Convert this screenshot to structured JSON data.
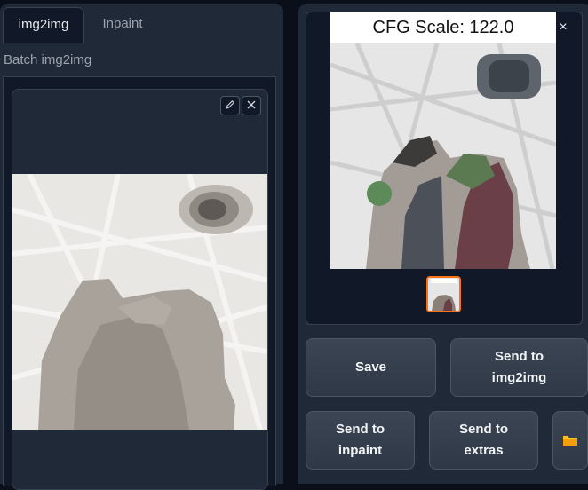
{
  "left_tabs": {
    "items": [
      {
        "label": "img2img",
        "active": true
      },
      {
        "label": "Inpaint",
        "active": false
      }
    ],
    "batch_label": "Batch img2img"
  },
  "image_editor": {
    "edit_icon": "pencil-icon",
    "close_icon": "close-icon"
  },
  "gallery": {
    "caption": "CFG Scale: 122.0",
    "close_label": "×",
    "selected_thumbnail": 1
  },
  "actions": {
    "save": "Save",
    "send_img2img": "Send to img2img",
    "send_inpaint": "Send to inpaint",
    "send_extras": "Send to extras",
    "folder_icon": "folder-icon"
  },
  "colors": {
    "background": "#0b0f19",
    "panel": "#1f2937",
    "accent": "#f97316",
    "folder": "#fbbf24"
  }
}
